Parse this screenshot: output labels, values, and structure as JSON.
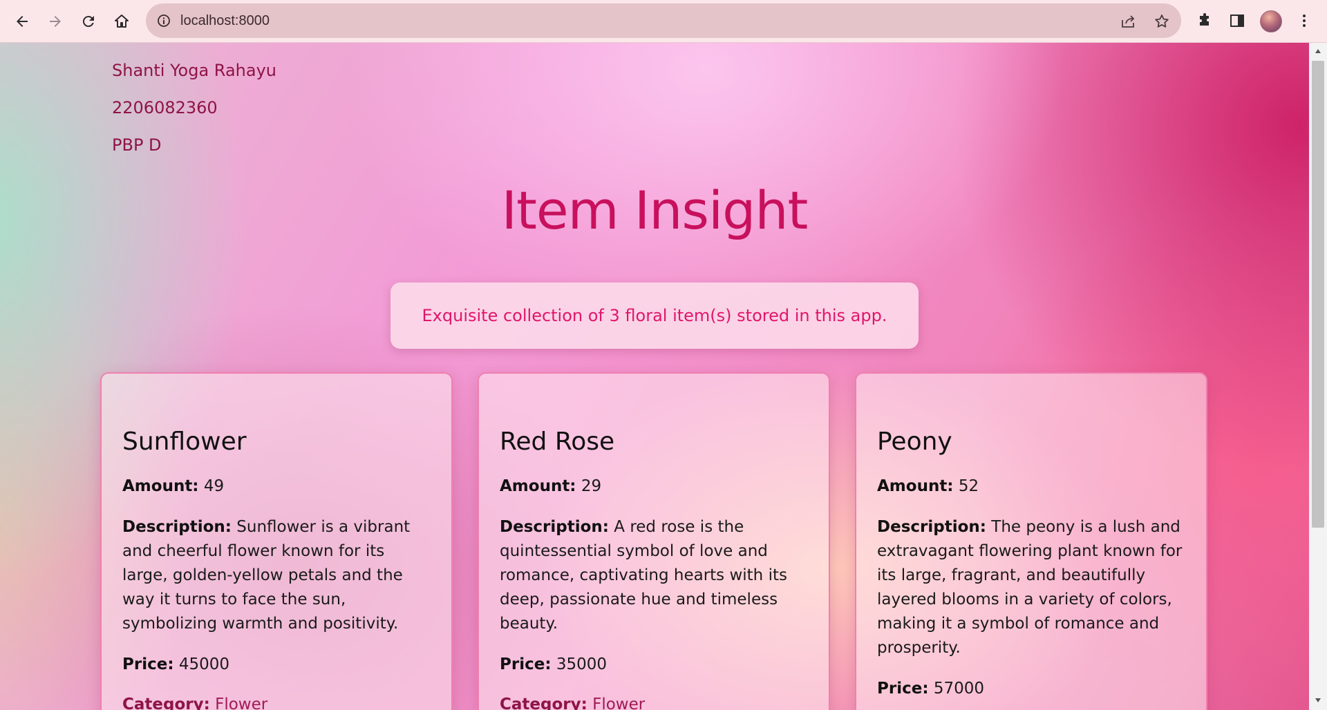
{
  "browser": {
    "url": "localhost:8000",
    "icons": [
      "back-arrow-icon",
      "forward-arrow-icon",
      "reload-icon",
      "home-icon",
      "info-icon",
      "share-icon",
      "star-icon",
      "extensions-puzzle-icon",
      "side-panel-icon",
      "profile-avatar",
      "kebab-menu-icon"
    ]
  },
  "student": {
    "name": "Shanti Yoga Rahayu",
    "npm": "2206082360",
    "class": "PBP D"
  },
  "page": {
    "title": "Item Insight",
    "notice": "Exquisite collection of 3 floral item(s) stored in this app."
  },
  "labels": {
    "amount": "Amount:",
    "description": "Description:",
    "price": "Price:",
    "category": "Category:"
  },
  "items": [
    {
      "name": "Sunflower",
      "amount": "49",
      "description": "Sunflower is a vibrant and cheerful flower known for its large, golden-yellow petals and the way it turns to face the sun, symbolizing warmth and positivity.",
      "price": "45000",
      "category": "Flower"
    },
    {
      "name": "Red Rose",
      "amount": "29",
      "description": "A red rose is the quintessential symbol of love and romance, captivating hearts with its deep, passionate hue and timeless beauty.",
      "price": "35000",
      "category": "Flower"
    },
    {
      "name": "Peony",
      "amount": "52",
      "description": "The peony is a lush and extravagant flowering plant known for its large, fragrant, and beautifully layered blooms in a variety of colors, making it a symbol of romance and prosperity.",
      "price": "57000"
    }
  ],
  "colors": {
    "accent": "#c8105c",
    "notice_text": "#e0166a",
    "card_border": "#f07fb0",
    "student_text": "#8e1446"
  }
}
